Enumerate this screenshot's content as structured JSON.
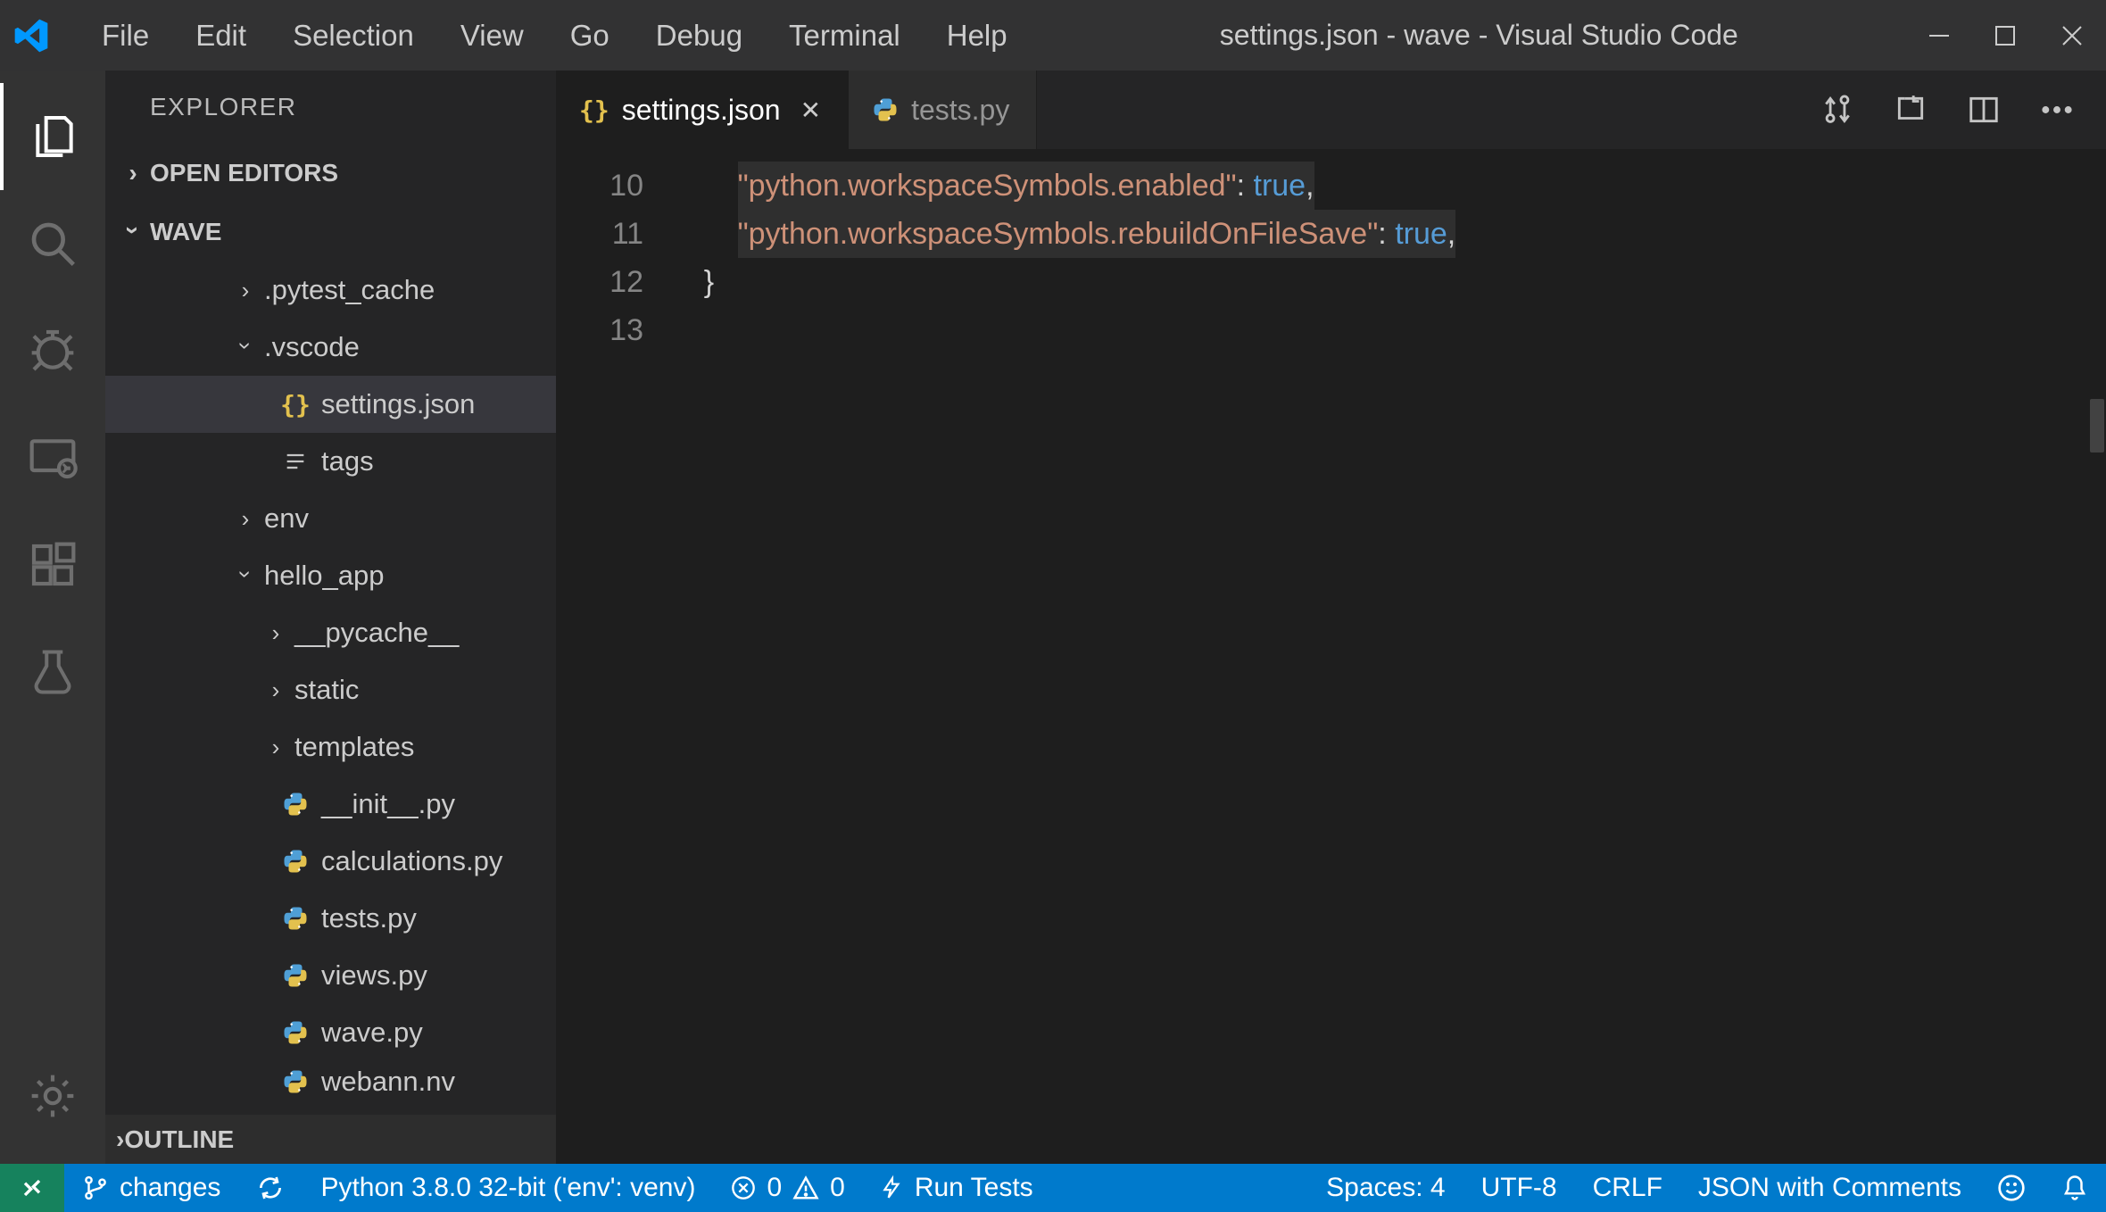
{
  "menubar": {
    "items": [
      "File",
      "Edit",
      "Selection",
      "View",
      "Go",
      "Debug",
      "Terminal",
      "Help"
    ],
    "title": "settings.json - wave - Visual Studio Code"
  },
  "sidebar": {
    "title": "EXPLORER",
    "sections": {
      "open_editors": "OPEN EDITORS",
      "workspace": "WAVE",
      "outline": "OUTLINE"
    },
    "tree": [
      {
        "indent": 40,
        "chev": ">",
        "label": ".pytest_cache",
        "type": "folder"
      },
      {
        "indent": 40,
        "chev": "v",
        "label": ".vscode",
        "type": "folder"
      },
      {
        "indent": 58,
        "icon": "json",
        "label": "settings.json",
        "type": "file",
        "selected": true
      },
      {
        "indent": 58,
        "icon": "lines",
        "label": "tags",
        "type": "file"
      },
      {
        "indent": 40,
        "chev": ">",
        "label": "env",
        "type": "folder"
      },
      {
        "indent": 40,
        "chev": "v",
        "label": "hello_app",
        "type": "folder"
      },
      {
        "indent": 74,
        "chev": ">",
        "label": "__pycache__",
        "type": "folder"
      },
      {
        "indent": 74,
        "chev": ">",
        "label": "static",
        "type": "folder"
      },
      {
        "indent": 74,
        "chev": ">",
        "label": "templates",
        "type": "folder"
      },
      {
        "indent": 58,
        "icon": "py",
        "label": "__init__.py",
        "type": "file"
      },
      {
        "indent": 58,
        "icon": "py",
        "label": "calculations.py",
        "type": "file"
      },
      {
        "indent": 58,
        "icon": "py",
        "label": "tests.py",
        "type": "file"
      },
      {
        "indent": 58,
        "icon": "py",
        "label": "views.py",
        "type": "file"
      },
      {
        "indent": 58,
        "icon": "py",
        "label": "wave.py",
        "type": "file"
      },
      {
        "indent": 58,
        "icon": "py",
        "label": "webann.nv",
        "type": "file",
        "cut": true
      }
    ]
  },
  "tabs": [
    {
      "icon": "json",
      "label": "settings.json",
      "active": true,
      "closeable": true
    },
    {
      "icon": "py",
      "label": "tests.py",
      "active": false,
      "closeable": false
    }
  ],
  "editor": {
    "lines": [
      {
        "n": "10",
        "indent": 2,
        "key": "\"python.workspaceSymbols.enabled\"",
        "sep": ": ",
        "val": "true",
        "tail": ",",
        "hl": true
      },
      {
        "n": "11",
        "indent": 2,
        "key": "\"python.workspaceSymbols.rebuildOnFileSave\"",
        "sep": ": ",
        "val": "true",
        "tail": ",",
        "hl": true
      },
      {
        "n": "12",
        "indent": 1,
        "raw": "}"
      },
      {
        "n": "13",
        "indent": 0,
        "raw": ""
      }
    ]
  },
  "status": {
    "branch": "changes",
    "python": "Python 3.8.0 32-bit ('env': venv)",
    "errors": "0",
    "warnings": "0",
    "runtests": "Run Tests",
    "spaces": "Spaces: 4",
    "encoding": "UTF-8",
    "eol": "CRLF",
    "lang": "JSON with Comments"
  }
}
